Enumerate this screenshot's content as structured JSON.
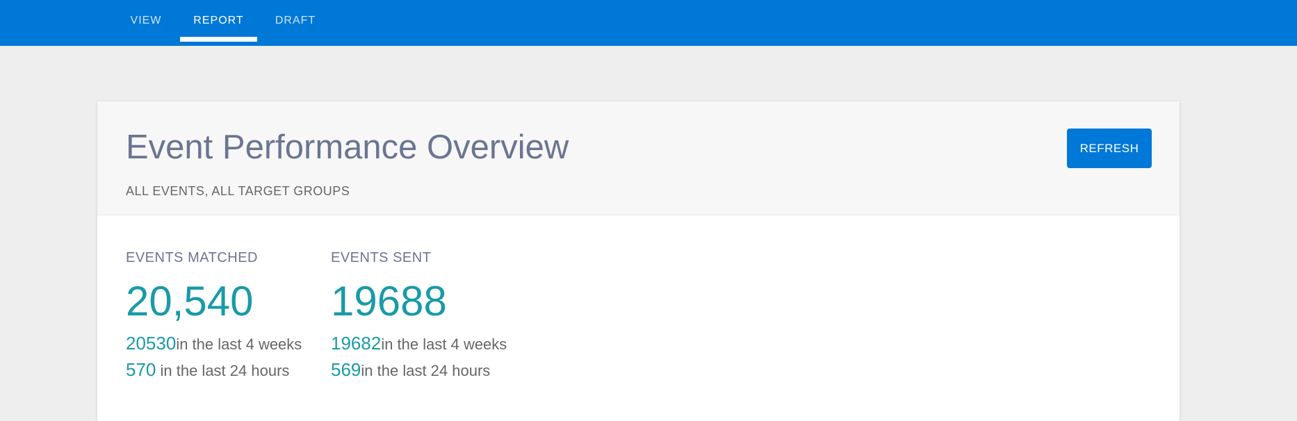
{
  "nav": {
    "tabs": [
      {
        "label": "VIEW",
        "active": false
      },
      {
        "label": "REPORT",
        "active": true
      },
      {
        "label": "DRAFT",
        "active": false
      }
    ]
  },
  "card": {
    "title": "Event Performance Overview",
    "subtitle": "ALL EVENTS, ALL TARGET GROUPS",
    "refresh_label": "REFRESH"
  },
  "metrics": {
    "matched": {
      "label": "EVENTS MATCHED",
      "value": "20,540",
      "weeks_count": "20530",
      "weeks_text": "in the last 4 weeks",
      "hours_count": "570",
      "hours_text": " in the last 24 hours"
    },
    "sent": {
      "label": "EVENTS SENT",
      "value": "19688",
      "weeks_count": "19682",
      "weeks_text": "in the last 4 weeks",
      "hours_count": "569",
      "hours_text": "in the last 24 hours"
    }
  },
  "colors": {
    "brand": "#0078d7",
    "accent_teal": "#1a9aa8",
    "title": "#6b7591",
    "background": "#eeeeee"
  }
}
